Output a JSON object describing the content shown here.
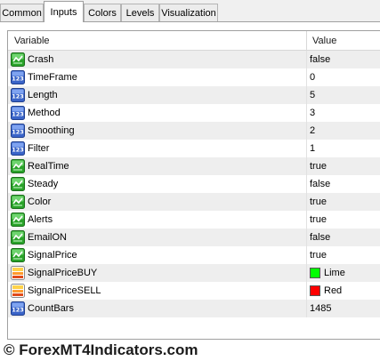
{
  "tabs": [
    {
      "label": "Common"
    },
    {
      "label": "Inputs"
    },
    {
      "label": "Colors"
    },
    {
      "label": "Levels"
    },
    {
      "label": "Visualization"
    }
  ],
  "active_tab": "Inputs",
  "columns": {
    "variable": "Variable",
    "value": "Value"
  },
  "rows": [
    {
      "name": "Crash",
      "value": "false",
      "type": "bool-icon"
    },
    {
      "name": "TimeFrame",
      "value": "0",
      "type": "int-icon"
    },
    {
      "name": "Length",
      "value": "5",
      "type": "int-icon"
    },
    {
      "name": "Method",
      "value": "3",
      "type": "int-icon"
    },
    {
      "name": "Smoothing",
      "value": "2",
      "type": "int-icon"
    },
    {
      "name": "Filter",
      "value": "1",
      "type": "int-icon"
    },
    {
      "name": "RealTime",
      "value": "true",
      "type": "bool-icon"
    },
    {
      "name": "Steady",
      "value": "false",
      "type": "bool-icon"
    },
    {
      "name": "Color",
      "value": "true",
      "type": "bool-icon"
    },
    {
      "name": "Alerts",
      "value": "true",
      "type": "bool-icon"
    },
    {
      "name": "EmailON",
      "value": "false",
      "type": "bool-icon"
    },
    {
      "name": "SignalPrice",
      "value": "true",
      "type": "bool-icon"
    },
    {
      "name": "SignalPriceBUY",
      "value": "Lime",
      "type": "color-icon",
      "swatch": "#00ff00"
    },
    {
      "name": "SignalPriceSELL",
      "value": "Red",
      "type": "color-icon",
      "swatch": "#ff0000"
    },
    {
      "name": "CountBars",
      "value": "1485",
      "type": "int-icon"
    }
  ],
  "watermark": "© ForexMT4Indicators.com"
}
